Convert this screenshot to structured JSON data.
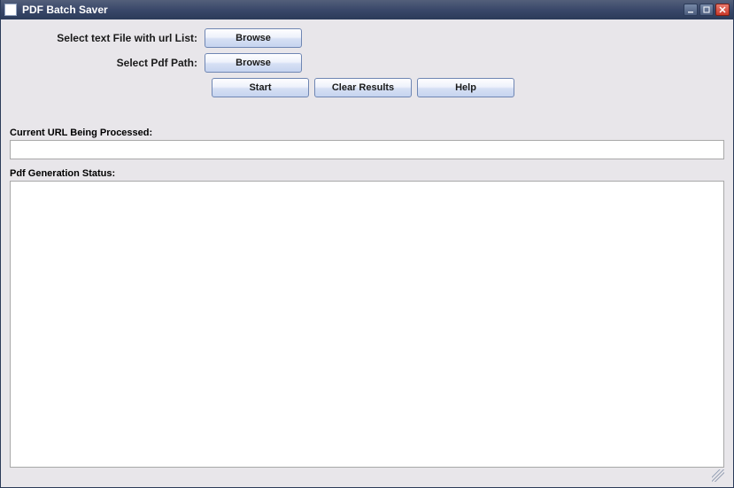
{
  "window": {
    "title": "PDF Batch Saver"
  },
  "form": {
    "url_list_label": "Select text File with url List:",
    "pdf_path_label": "Select Pdf Path:",
    "browse_url_list_button": "Browse",
    "browse_pdf_path_button": "Browse",
    "start_button": "Start",
    "clear_results_button": "Clear Results",
    "help_button": "Help"
  },
  "status": {
    "current_url_label": "Current URL Being Processed:",
    "current_url_value": "",
    "generation_status_label": "Pdf Generation Status:",
    "generation_status_value": ""
  }
}
